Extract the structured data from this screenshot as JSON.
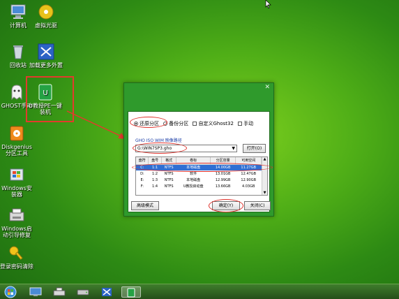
{
  "desktop": {
    "icons": [
      {
        "label": "计算机",
        "icon": "computer-icon"
      },
      {
        "label": "虚拟光驱",
        "icon": "virtual-drive-icon"
      },
      {
        "label": "回收站",
        "icon": "recycle-bin-icon"
      },
      {
        "label": "加载更多外置",
        "icon": "load-more-icon"
      },
      {
        "label": "GHOST手动",
        "icon": "ghost-icon"
      },
      {
        "label": "U教授PE一键装机",
        "icon": "pe-installer-icon"
      },
      {
        "label": "Diskgenius分区工具",
        "icon": "diskgenius-icon"
      },
      {
        "label": "Windows安装器",
        "icon": "windows-installer-icon"
      },
      {
        "label": "Windows启动引导修复",
        "icon": "boot-repair-icon"
      },
      {
        "label": "登录密码清除",
        "icon": "password-key-icon"
      }
    ]
  },
  "dialog": {
    "modes": {
      "restore": "还原分区",
      "backup": "备份分区",
      "custom": "自定义Ghost32",
      "manual": "手动"
    },
    "path_label": "GHO ISO WIM 映像路径",
    "path_value": "G:\\WIN7SP3.gho",
    "open_button": "打开(O)",
    "table": {
      "headers": [
        "盘符",
        "盘号",
        "格式",
        "卷标",
        "分区容量",
        "可用空间"
      ],
      "rows": [
        [
          "C:",
          "1:1",
          "NTFS",
          "本地磁盘",
          "14.00GB",
          "11.27GB"
        ],
        [
          "D:",
          "1:2",
          "NTFS",
          "软件",
          "13.01GB",
          "12.47GB"
        ],
        [
          "E:",
          "1:3",
          "NTFS",
          "本地磁盘",
          "12.99GB",
          "12.90GB"
        ],
        [
          "F:",
          "1:4",
          "NTFS",
          "U教授启动盘",
          "13.66GB",
          "4.03GB"
        ]
      ]
    },
    "advanced_button": "高级模式",
    "ok_button": "确定(Y)",
    "close_button": "关闭(C)"
  },
  "colors": {
    "desktop_green": "#4fae17",
    "dialog_frame": "#2f9a2c",
    "selection": "#2f6fd3",
    "callout_red": "#e23b2c"
  }
}
